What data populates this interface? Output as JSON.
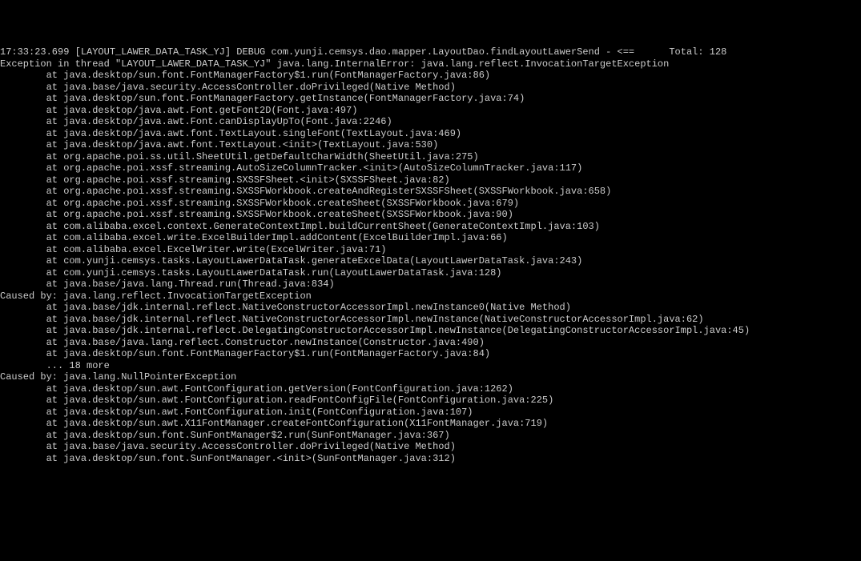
{
  "lines": [
    "17:33:23.699 [LAYOUT_LAWER_DATA_TASK_YJ] DEBUG com.yunji.cemsys.dao.mapper.LayoutDao.findLayoutLawerSend - <==      Total: 128",
    "Exception in thread \"LAYOUT_LAWER_DATA_TASK_YJ\" java.lang.InternalError: java.lang.reflect.InvocationTargetException",
    "        at java.desktop/sun.font.FontManagerFactory$1.run(FontManagerFactory.java:86)",
    "        at java.base/java.security.AccessController.doPrivileged(Native Method)",
    "        at java.desktop/sun.font.FontManagerFactory.getInstance(FontManagerFactory.java:74)",
    "        at java.desktop/java.awt.Font.getFont2D(Font.java:497)",
    "        at java.desktop/java.awt.Font.canDisplayUpTo(Font.java:2246)",
    "        at java.desktop/java.awt.font.TextLayout.singleFont(TextLayout.java:469)",
    "        at java.desktop/java.awt.font.TextLayout.<init>(TextLayout.java:530)",
    "        at org.apache.poi.ss.util.SheetUtil.getDefaultCharWidth(SheetUtil.java:275)",
    "        at org.apache.poi.xssf.streaming.AutoSizeColumnTracker.<init>(AutoSizeColumnTracker.java:117)",
    "        at org.apache.poi.xssf.streaming.SXSSFSheet.<init>(SXSSFSheet.java:82)",
    "        at org.apache.poi.xssf.streaming.SXSSFWorkbook.createAndRegisterSXSSFSheet(SXSSFWorkbook.java:658)",
    "        at org.apache.poi.xssf.streaming.SXSSFWorkbook.createSheet(SXSSFWorkbook.java:679)",
    "        at org.apache.poi.xssf.streaming.SXSSFWorkbook.createSheet(SXSSFWorkbook.java:90)",
    "        at com.alibaba.excel.context.GenerateContextImpl.buildCurrentSheet(GenerateContextImpl.java:103)",
    "        at com.alibaba.excel.write.ExcelBuilderImpl.addContent(ExcelBuilderImpl.java:66)",
    "        at com.alibaba.excel.ExcelWriter.write(ExcelWriter.java:71)",
    "        at com.yunji.cemsys.tasks.LayoutLawerDataTask.generateExcelData(LayoutLawerDataTask.java:243)",
    "        at com.yunji.cemsys.tasks.LayoutLawerDataTask.run(LayoutLawerDataTask.java:128)",
    "        at java.base/java.lang.Thread.run(Thread.java:834)",
    "Caused by: java.lang.reflect.InvocationTargetException",
    "        at java.base/jdk.internal.reflect.NativeConstructorAccessorImpl.newInstance0(Native Method)",
    "        at java.base/jdk.internal.reflect.NativeConstructorAccessorImpl.newInstance(NativeConstructorAccessorImpl.java:62)",
    "        at java.base/jdk.internal.reflect.DelegatingConstructorAccessorImpl.newInstance(DelegatingConstructorAccessorImpl.java:45)",
    "        at java.base/java.lang.reflect.Constructor.newInstance(Constructor.java:490)",
    "        at java.desktop/sun.font.FontManagerFactory$1.run(FontManagerFactory.java:84)",
    "        ... 18 more",
    "Caused by: java.lang.NullPointerException",
    "        at java.desktop/sun.awt.FontConfiguration.getVersion(FontConfiguration.java:1262)",
    "        at java.desktop/sun.awt.FontConfiguration.readFontConfigFile(FontConfiguration.java:225)",
    "        at java.desktop/sun.awt.FontConfiguration.init(FontConfiguration.java:107)",
    "        at java.desktop/sun.awt.X11FontManager.createFontConfiguration(X11FontManager.java:719)",
    "        at java.desktop/sun.font.SunFontManager$2.run(SunFontManager.java:367)",
    "        at java.base/java.security.AccessController.doPrivileged(Native Method)",
    "        at java.desktop/sun.font.SunFontManager.<init>(SunFontManager.java:312)"
  ]
}
